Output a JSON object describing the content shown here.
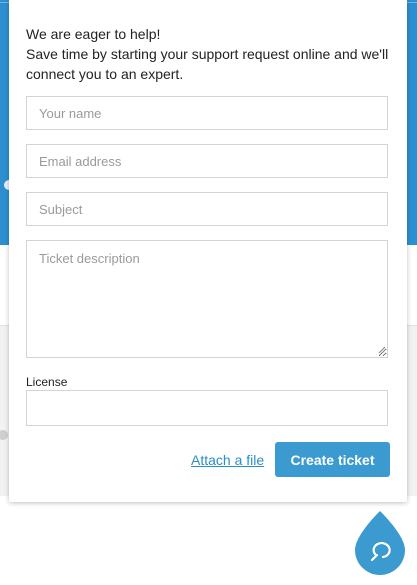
{
  "colors": {
    "hero_background": "#2d8fd0",
    "primary_button": "#3b9ad0",
    "link": "#2a8fc7",
    "launcher": "#3b9ad0"
  },
  "intro": {
    "line1": "We are eager to help!",
    "line2": "Save time by starting your support request online and we'll",
    "line3": "connect you to an expert."
  },
  "form": {
    "name_placeholder": "Your name",
    "email_placeholder": "Email address",
    "subject_placeholder": "Subject",
    "description_placeholder": "Ticket description",
    "license_label": "License",
    "license_value": "",
    "attach_label": "Attach a file",
    "submit_label": "Create ticket"
  },
  "launcher": {
    "icon": "chat-bubble-icon"
  }
}
